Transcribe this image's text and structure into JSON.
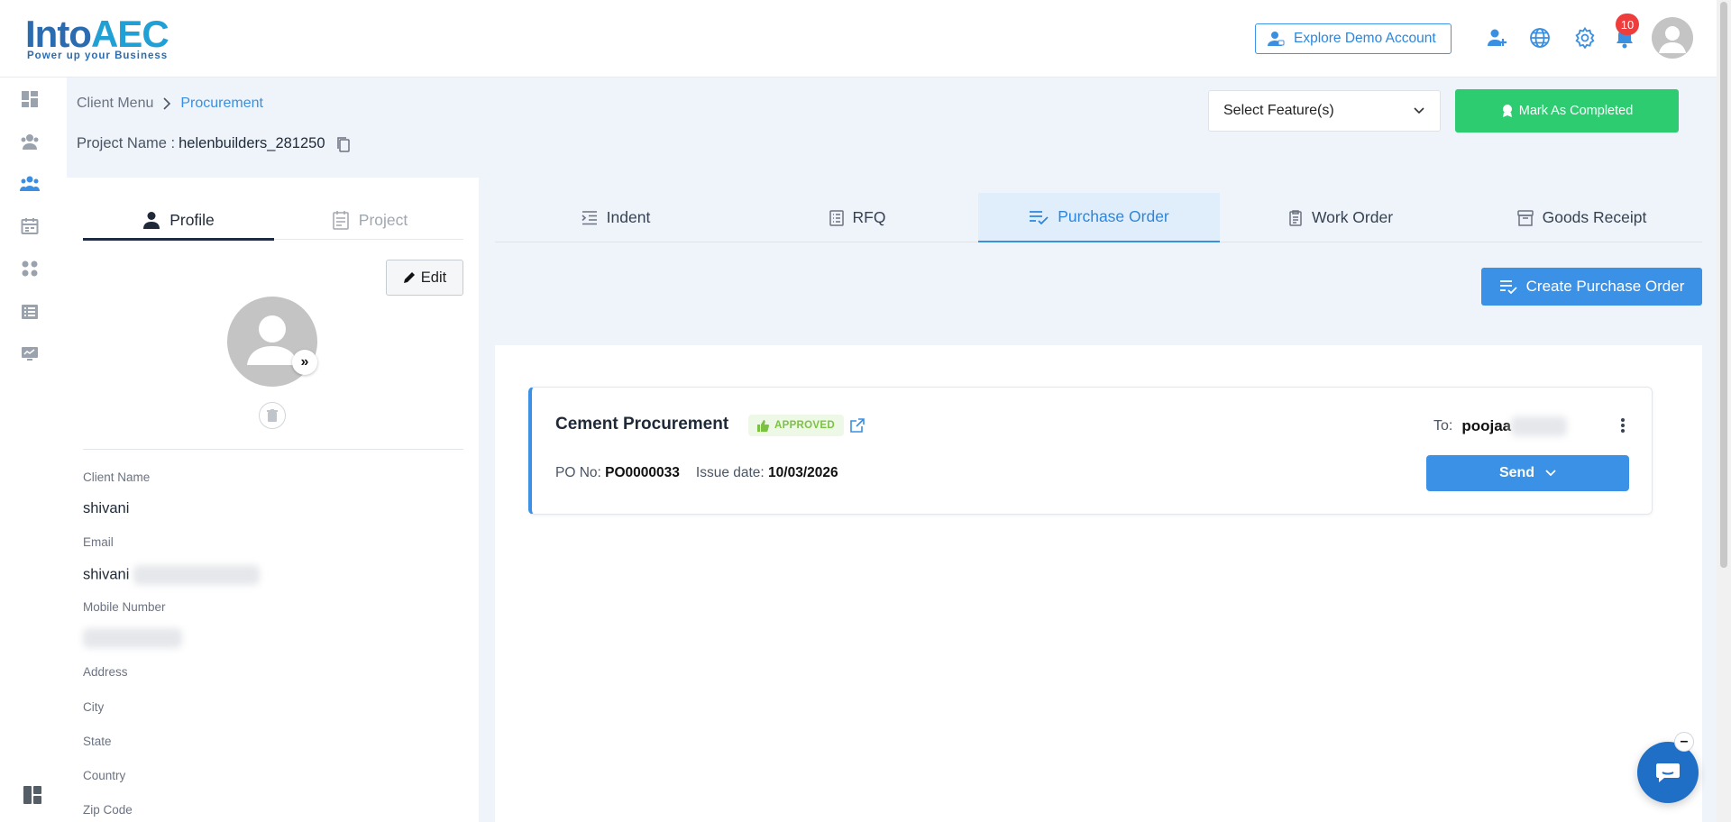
{
  "brand": {
    "name_main": "Into",
    "name_accent": "AEC",
    "tagline": "Power up your Business"
  },
  "header": {
    "demo_button": "Explore Demo Account",
    "notification_count": "10",
    "icons": [
      "add-user-icon",
      "globe-icon",
      "gear-icon",
      "bell-icon",
      "avatar"
    ]
  },
  "sidebar": {
    "items": [
      "dashboard-icon",
      "clients-icon",
      "users-group-icon",
      "calendar-icon",
      "modules-icon",
      "list-icon",
      "monitor-icon"
    ],
    "footer_icon": "layout-icon"
  },
  "breadcrumb": {
    "root": "Client Menu",
    "current": "Procurement"
  },
  "project": {
    "label": "Project Name : ",
    "value": "helenbuilders_281250"
  },
  "feature_select": {
    "value": "Select Feature(s)"
  },
  "mark_completed": {
    "label": "Mark As Completed"
  },
  "left_tabs": [
    {
      "label": "Profile",
      "active": true
    },
    {
      "label": "Project",
      "active": false
    }
  ],
  "profile": {
    "edit_label": "Edit",
    "fields": [
      {
        "label": "Client Name",
        "value": "shivani"
      },
      {
        "label": "Email",
        "value": "shivani"
      },
      {
        "label": "Mobile Number",
        "value": ""
      },
      {
        "label": "Address",
        "value": ""
      },
      {
        "label": "City",
        "value": ""
      },
      {
        "label": "State",
        "value": ""
      },
      {
        "label": "Country",
        "value": ""
      },
      {
        "label": "Zip Code",
        "value": ""
      }
    ]
  },
  "procurement_tabs": [
    {
      "label": "Indent",
      "icon": "indent-icon",
      "active": false
    },
    {
      "label": "RFQ",
      "icon": "rfq-icon",
      "active": false
    },
    {
      "label": "Purchase Order",
      "icon": "purchase-order-icon",
      "active": true
    },
    {
      "label": "Work Order",
      "icon": "work-order-icon",
      "active": false
    },
    {
      "label": "Goods Receipt",
      "icon": "goods-receipt-icon",
      "active": false
    }
  ],
  "create_button": {
    "label": "Create Purchase Order"
  },
  "purchase_orders": [
    {
      "title": "Cement Procurement",
      "status": "APPROVED",
      "to_label": "To:",
      "to_name": "poojaa",
      "po_no_label": "PO No:",
      "po_no": "PO0000033",
      "issue_label": "Issue date:",
      "issue_date": "10/03/2026",
      "send_label": "Send"
    }
  ],
  "colors": {
    "primary": "#3a91e6",
    "success": "#2ecc71",
    "approved_text": "#7cc242",
    "badge": "#ee3d3d"
  }
}
